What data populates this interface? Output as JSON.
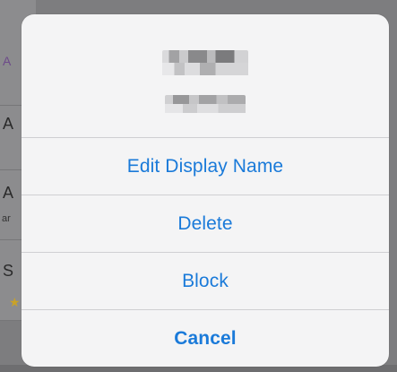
{
  "background": {
    "letters": [
      "A",
      "A",
      "A",
      "ar",
      "S"
    ]
  },
  "sheet": {
    "actions": [
      {
        "label": "Edit Display Name"
      },
      {
        "label": "Delete"
      },
      {
        "label": "Block"
      },
      {
        "label": "Cancel"
      }
    ]
  },
  "colors": {
    "action_text": "#1a7ad9",
    "sheet_bg": "#f4f4f5",
    "divider": "#cfcfd2",
    "dim_bg": "#7d7d7f"
  }
}
